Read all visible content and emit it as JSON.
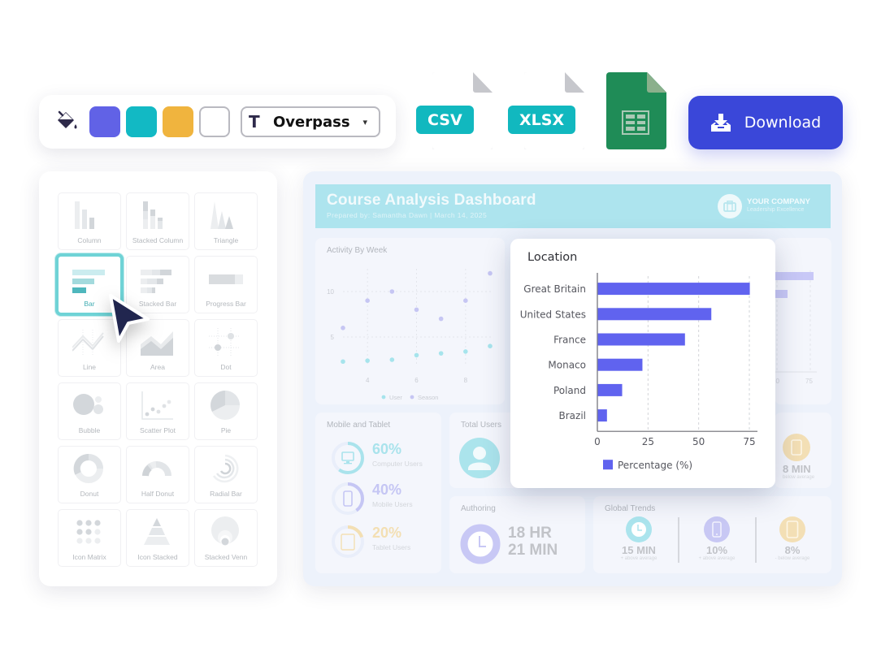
{
  "toolbar": {
    "paint_icon": "paint-bucket-icon",
    "swatches": [
      {
        "name": "purple",
        "color": "#6162e6"
      },
      {
        "name": "teal",
        "color": "#12b9c4"
      },
      {
        "name": "amber",
        "color": "#f0b43e"
      },
      {
        "name": "white",
        "color": "#ffffff"
      }
    ],
    "font_icon": "T",
    "font_name": "Overpass",
    "font_chevron": "⌄"
  },
  "exports": {
    "csv_label": "CSV",
    "xlsx_label": "XLSX",
    "sheets_icon": "google-sheets-icon",
    "download_label": "Download"
  },
  "chart_types": [
    {
      "label": "Column",
      "icon": "column"
    },
    {
      "label": "Stacked Column",
      "icon": "stacked-column"
    },
    {
      "label": "Triangle",
      "icon": "triangle"
    },
    {
      "label": "Bar",
      "icon": "bar",
      "selected": true
    },
    {
      "label": "Stacked Bar",
      "icon": "stacked-bar"
    },
    {
      "label": "Progress Bar",
      "icon": "progress-bar"
    },
    {
      "label": "Line",
      "icon": "line"
    },
    {
      "label": "Area",
      "icon": "area"
    },
    {
      "label": "Dot",
      "icon": "dot"
    },
    {
      "label": "Bubble",
      "icon": "bubble"
    },
    {
      "label": "Scatter Plot",
      "icon": "scatter"
    },
    {
      "label": "Pie",
      "icon": "pie"
    },
    {
      "label": "Donut",
      "icon": "donut"
    },
    {
      "label": "Half Donut",
      "icon": "half-donut"
    },
    {
      "label": "Radial Bar",
      "icon": "radial-bar"
    },
    {
      "label": "Icon Matrix",
      "icon": "icon-matrix"
    },
    {
      "label": "Icon Stacked",
      "icon": "icon-stacked"
    },
    {
      "label": "Stacked Venn",
      "icon": "stacked-venn"
    }
  ],
  "dashboard": {
    "title": "Course Analysis Dashboard",
    "subtitle": "Prepared by:  Samantha Dawn | March 14, 2025",
    "company_name": "YOUR COMPANY",
    "company_tagline": "Leadership Excellence",
    "activity": {
      "title": "Activity By Week",
      "legend": [
        {
          "name": "User",
          "color": "#a6e4ec"
        },
        {
          "name": "Season",
          "color": "#c6c6f3"
        }
      ]
    },
    "mobile": {
      "title": "Mobile and Tablet",
      "items": [
        {
          "pct": "60%",
          "label": "Computer Users",
          "fraction": 0.6,
          "color": "#a9e3ec",
          "icon": "monitor-icon"
        },
        {
          "pct": "40%",
          "label": "Mobile Users",
          "fraction": 0.4,
          "color": "#c5c6f4",
          "icon": "phone-icon"
        },
        {
          "pct": "20%",
          "label": "Tablet Users",
          "fraction": 0.2,
          "color": "#f3dfb3",
          "icon": "tablet-icon"
        }
      ]
    },
    "total_users": {
      "title": "Total Users"
    },
    "time_card": {
      "value": "8 MIN",
      "note": "below average"
    },
    "authoring": {
      "title": "Authoring",
      "hours": "18 HR",
      "minutes": "21 MIN"
    },
    "global_trends": {
      "title": "Global Trends",
      "items": [
        {
          "value": "15 MIN",
          "note": "+ above average",
          "icon": "clock-icon",
          "color": "#abe4ed"
        },
        {
          "value": "10%",
          "note": "+ above average",
          "icon": "phone-icon",
          "color": "#c8c8f4"
        },
        {
          "value": "8%",
          "note": "- below average",
          "icon": "tablet-icon",
          "color": "#f3dfb5"
        }
      ]
    }
  },
  "chart_data": [
    {
      "type": "bar",
      "orientation": "horizontal",
      "title": "Location",
      "categories": [
        "Great Britain",
        "United States",
        "France",
        "Monaco",
        "Poland",
        "Brazil"
      ],
      "series": [
        {
          "name": "Percentage (%)",
          "values": [
            75,
            56,
            43,
            22,
            12,
            4.5
          ],
          "color": "#6063ef"
        }
      ],
      "xlabel": "",
      "ylabel": "",
      "xlim": [
        0,
        80
      ],
      "xticks": [
        0,
        25,
        50,
        75
      ],
      "grid": "vertical-dashed",
      "legend": "bottom"
    },
    {
      "type": "scatter",
      "title": "Activity By Week",
      "series": [
        {
          "name": "User",
          "x": [
            3,
            4,
            5,
            6,
            7,
            8,
            9
          ],
          "y": [
            2.3,
            2.4,
            2.5,
            3.0,
            3.2,
            3.4,
            4.0
          ]
        },
        {
          "name": "Season",
          "x": [
            3,
            4,
            5,
            6,
            7,
            8,
            9
          ],
          "y": [
            6,
            9,
            10,
            8,
            7,
            9,
            12
          ]
        }
      ],
      "xticks": [
        4,
        6,
        8
      ],
      "yticks": [
        5,
        10
      ],
      "xlim": [
        3,
        9
      ],
      "ylim": [
        1.5,
        13
      ],
      "grid": "dashed",
      "legend": "bottom"
    }
  ]
}
